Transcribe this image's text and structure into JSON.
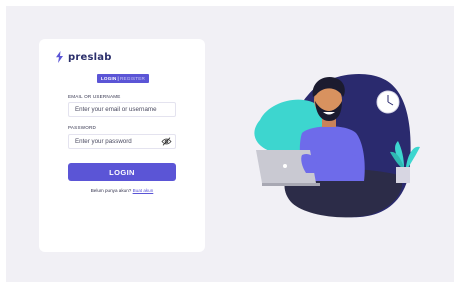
{
  "brand": {
    "name": "preslab",
    "icon": "bolt-logo-icon"
  },
  "tabs": {
    "login": "LOGIN",
    "separator": "|",
    "register": "REGISTER"
  },
  "form": {
    "email_label": "EMAIL OR USERNAME",
    "email_placeholder": "Enter your email or username",
    "password_label": "PASSWORD",
    "password_placeholder": "Enter your password",
    "eye_icon": "eye-slash-icon",
    "submit_label": "LOGIN",
    "signup_text": "Belum punya akun?",
    "signup_link": "Buat akun"
  },
  "illustration": {
    "name": "man-with-laptop-illustration"
  },
  "colors": {
    "accent": "#5b55d6",
    "brand_text": "#2b2f6b",
    "teal": "#3dd6cf",
    "navy": "#2a2a6e",
    "background": "#f1f0f5"
  }
}
